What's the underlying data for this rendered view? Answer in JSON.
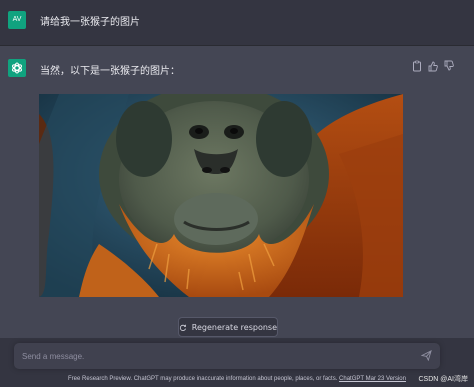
{
  "conversation": {
    "user": {
      "avatar_initials": "AV",
      "message": "请给我一张猴子的图片"
    },
    "assistant": {
      "icon": "chatgpt-logo-icon",
      "message": "当然，以下是一张猴子的图片：",
      "actions": [
        "copy-icon",
        "thumbs-up-icon",
        "thumbs-down-icon"
      ]
    }
  },
  "regenerate_label": "Regenerate response",
  "input": {
    "placeholder": "Send a message."
  },
  "footer": {
    "text": "Free Research Preview. ChatGPT may produce inaccurate information about people, places, or facts. ",
    "link": "ChatGPT Mar 23 Version"
  },
  "watermark": "CSDN @AI湾岸",
  "colors": {
    "accent": "#10a37f",
    "page_bg": "#343541",
    "assistant_bg": "#444654",
    "input_bg": "#40414f"
  }
}
